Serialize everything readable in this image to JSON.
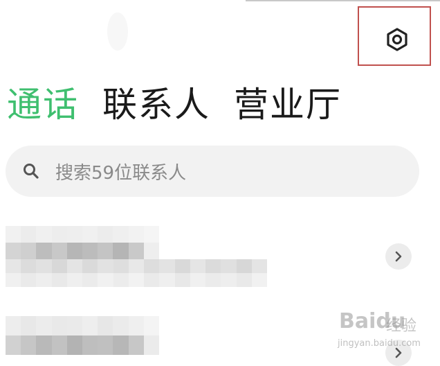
{
  "header": {
    "settings_icon": "gear-icon"
  },
  "tabs": [
    {
      "label": "通话",
      "active": true
    },
    {
      "label": "联系人",
      "active": false
    },
    {
      "label": "营业厅",
      "active": false
    }
  ],
  "search": {
    "placeholder": "搜索59位联系人",
    "icon": "search-icon"
  },
  "contacts": [
    {
      "name": "",
      "detail": "",
      "pixelated": true
    },
    {
      "name": "",
      "detail": "",
      "pixelated": true
    }
  ],
  "watermark": {
    "brand": "Baidu",
    "brand_cn": "经验",
    "url": "jingyan.baidu.com"
  },
  "colors": {
    "accent": "#3fbf6f",
    "highlight_box": "#c0504d"
  }
}
